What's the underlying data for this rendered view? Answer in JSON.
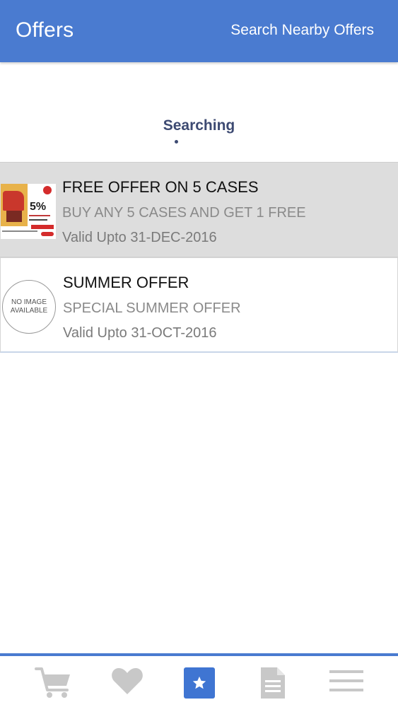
{
  "header": {
    "title": "Offers",
    "action_label": "Search Nearby Offers"
  },
  "status": {
    "text": "Searching"
  },
  "offers": [
    {
      "name": "FREE OFFER ON 5 CASES",
      "description": "BUY ANY 5 CASES AND GET 1 FREE",
      "validity": "Valid Upto 31-DEC-2016",
      "image": "promo-banner",
      "promo_text": "5%",
      "selected": true
    },
    {
      "name": "SUMMER OFFER",
      "description": "SPECIAL SUMMER OFFER",
      "validity": "Valid Upto 31-OCT-2016",
      "image": "no-image-placeholder",
      "placeholder_line1": "NO IMAGE",
      "placeholder_line2": "AVAILABLE",
      "selected": false
    }
  ],
  "bottom_nav": {
    "items": [
      {
        "icon": "cart-icon",
        "active": false
      },
      {
        "icon": "heart-icon",
        "active": false
      },
      {
        "icon": "star-icon",
        "active": true
      },
      {
        "icon": "document-icon",
        "active": false
      },
      {
        "icon": "menu-icon",
        "active": false
      }
    ],
    "accent": "#4a7bd0",
    "inactive_color": "#c8c8c8"
  }
}
